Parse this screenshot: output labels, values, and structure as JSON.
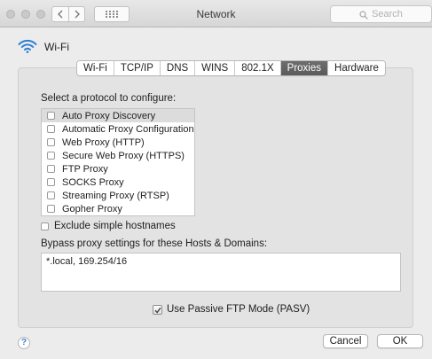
{
  "window": {
    "title": "Network"
  },
  "search": {
    "placeholder": "Search"
  },
  "header": {
    "interface_name": "Wi-Fi"
  },
  "tabs": [
    {
      "label": "Wi-Fi",
      "active": false
    },
    {
      "label": "TCP/IP",
      "active": false
    },
    {
      "label": "DNS",
      "active": false
    },
    {
      "label": "WINS",
      "active": false
    },
    {
      "label": "802.1X",
      "active": false
    },
    {
      "label": "Proxies",
      "active": true
    },
    {
      "label": "Hardware",
      "active": false
    }
  ],
  "proxies": {
    "protocol_prompt": "Select a protocol to configure:",
    "protocols": [
      {
        "label": "Auto Proxy Discovery",
        "checked": false,
        "selected": true
      },
      {
        "label": "Automatic Proxy Configuration",
        "checked": false,
        "selected": false
      },
      {
        "label": "Web Proxy (HTTP)",
        "checked": false,
        "selected": false
      },
      {
        "label": "Secure Web Proxy (HTTPS)",
        "checked": false,
        "selected": false
      },
      {
        "label": "FTP Proxy",
        "checked": false,
        "selected": false
      },
      {
        "label": "SOCKS Proxy",
        "checked": false,
        "selected": false
      },
      {
        "label": "Streaming Proxy (RTSP)",
        "checked": false,
        "selected": false
      },
      {
        "label": "Gopher Proxy",
        "checked": false,
        "selected": false
      }
    ],
    "exclude_simple_hostnames": {
      "label": "Exclude simple hostnames",
      "checked": false
    },
    "bypass_label": "Bypass proxy settings for these Hosts & Domains:",
    "bypass_value": "*.local, 169.254/16",
    "passive_ftp": {
      "label": "Use Passive FTP Mode (PASV)",
      "checked": true
    }
  },
  "footer": {
    "help_glyph": "?",
    "cancel_label": "Cancel",
    "ok_label": "OK"
  },
  "colors": {
    "accent_wifi": "#2f7fd8",
    "active_tab": "#636363"
  }
}
